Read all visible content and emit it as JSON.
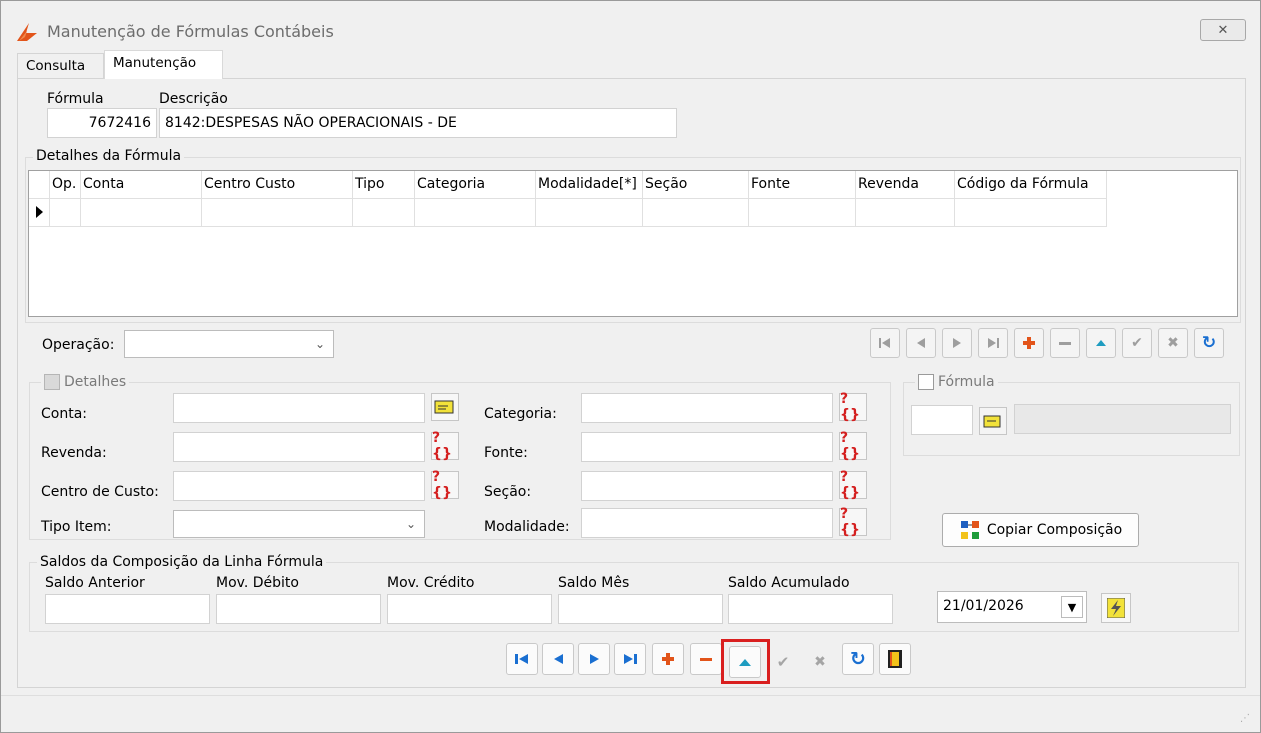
{
  "window": {
    "title": "Manutenção de Fórmulas Contábeis",
    "close_label": "✕"
  },
  "tabs": [
    {
      "label": "Consulta",
      "active": false
    },
    {
      "label": "Manutenção",
      "active": true
    }
  ],
  "formula": {
    "formula_label": "Fórmula",
    "formula_value": "7672416",
    "descricao_label": "Descrição",
    "descricao_value": "8142:DESPESAS NÃO OPERACIONAIS - DE"
  },
  "detalhes_formula": {
    "title": "Detalhes da Fórmula",
    "columns": [
      "Op.",
      "Conta",
      "Centro Custo",
      "Tipo",
      "Categoria",
      "Modalidade[*]",
      "Seção",
      "Fonte",
      "Revenda",
      "Código da Fórmula"
    ],
    "rows": [
      [
        "",
        "",
        "",
        "",
        "",
        "",
        "",
        "",
        "",
        ""
      ]
    ]
  },
  "operacao": {
    "label": "Operação:",
    "value": ""
  },
  "detalhes": {
    "title": "Detalhes",
    "checked": true,
    "conta_label": "Conta:",
    "revenda_label": "Revenda:",
    "centro_label": "Centro de Custo:",
    "tipo_item_label": "Tipo Item:",
    "categoria_label": "Categoria:",
    "fonte_label": "Fonte:",
    "secao_label": "Seção:",
    "modalidade_label": "Modalidade:"
  },
  "formula_group": {
    "title": "Fórmula",
    "checked": false
  },
  "copiar_button": "Copiar Composição",
  "saldos": {
    "title": "Saldos da Composição da Linha Fórmula",
    "saldo_anterior": "Saldo Anterior",
    "mov_debito": "Mov. Débito",
    "mov_credito": "Mov. Crédito",
    "saldo_mes": "Saldo Mês",
    "saldo_acumulado": "Saldo Acumulado",
    "date_value": "21/01/2026"
  },
  "lookup_glyph": "?{}",
  "colors": {
    "nav_blue": "#1a6fd1",
    "add_orange": "#e2541a",
    "teal": "#1e9cc0",
    "highlight_red": "#d91f1f"
  }
}
